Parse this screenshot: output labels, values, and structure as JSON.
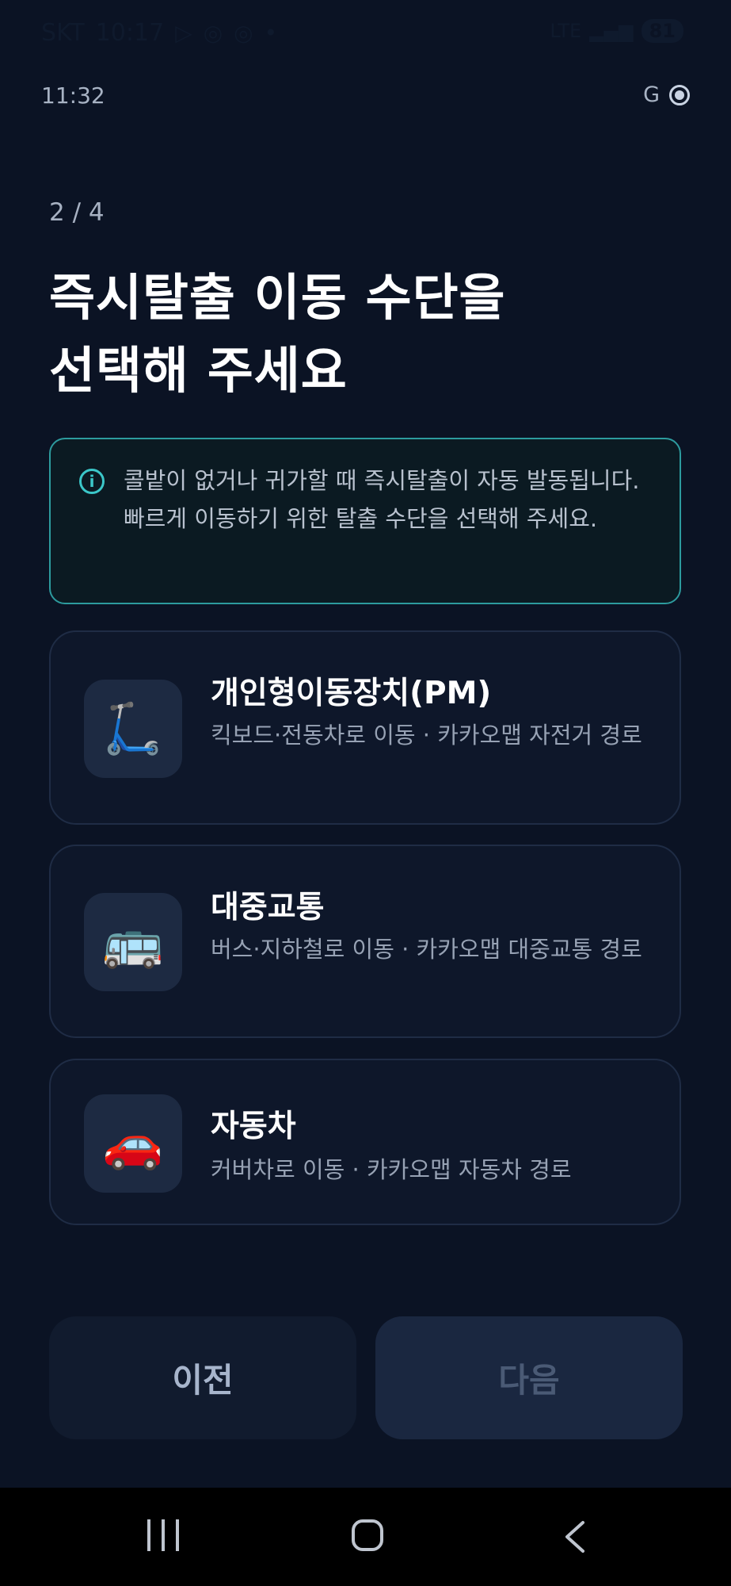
{
  "status_bar": {
    "carrier": "SKT",
    "time": "10:17",
    "battery": "81",
    "icons": [
      "play-store-icon",
      "instagram-icon",
      "instagram-icon",
      "dot-icon",
      "lte-icon",
      "signal-icon"
    ]
  },
  "app_bar": {
    "time": "11:32",
    "right_letter": "G"
  },
  "step": "2 / 4",
  "title": "즉시탈출 이동 수단을\n선택해 주세요",
  "info": {
    "icon": "info-icon",
    "text": "콜밭이 없거나 귀가할 때 즉시탈출이 자동 발동됩니다.\n빠르게 이동하기 위한 탈출 수단을 선택해 주세요."
  },
  "options": [
    {
      "icon": "🛴",
      "icon_name": "kick-scooter-icon",
      "title": "개인형이동장치(PM)",
      "desc": "킥보드·전동차로 이동 · 카카오맵 자전거 경로"
    },
    {
      "icon": "🚌",
      "icon_name": "bus-icon",
      "title": "대중교통",
      "desc": "버스·지하철로 이동 · 카카오맵 대중교통 경로"
    },
    {
      "icon": "🚗",
      "icon_name": "car-icon",
      "title": "자동차",
      "desc": "커버차로 이동 · 카카오맵 자동차 경로"
    }
  ],
  "buttons": {
    "prev": "이전",
    "next": "다음"
  },
  "colors": {
    "background": "#0b1324",
    "accent_teal": "#2d9b9e",
    "card": "#0e172a",
    "disabled_button": "#1a2740"
  }
}
